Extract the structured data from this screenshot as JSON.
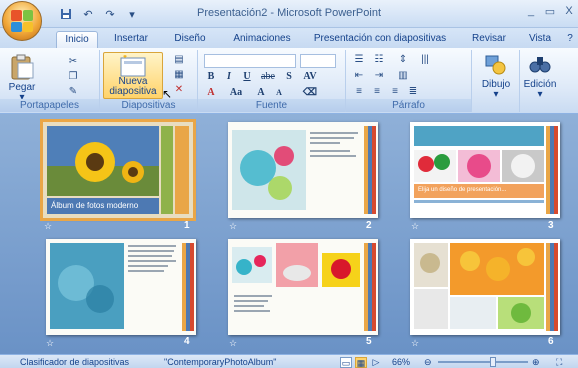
{
  "window": {
    "title": "Presentación2 - Microsoft PowerPoint",
    "controls": [
      "_",
      "▭",
      "X"
    ]
  },
  "quick_access": {
    "save_icon": "save-icon",
    "undo": "↶",
    "redo": "↷"
  },
  "tabs": [
    "Inicio",
    "Insertar",
    "Diseño",
    "Animaciones",
    "Presentación con diapositivas",
    "Revisar",
    "Vista"
  ],
  "ribbon": {
    "portapapeles": {
      "paste_label": "Pegar",
      "group_label": "Portapapeles"
    },
    "diapositivas": {
      "new_slide_line1": "Nueva",
      "new_slide_line2": "diapositiva",
      "group_label": "Diapositivas"
    },
    "fuente": {
      "group_label": "Fuente",
      "bold": "B",
      "italic": "I",
      "underline": "U",
      "strike": "abe",
      "shadow": "S",
      "grow": "A",
      "shrink": "A",
      "color": "A",
      "case": "Aa"
    },
    "parrafo": {
      "group_label": "Párrafo"
    },
    "dibujo": {
      "label": "Dibujo"
    },
    "edicion": {
      "label": "Edición"
    }
  },
  "slides": [
    {
      "number": "1",
      "caption": "Álbum de fotos moderno"
    },
    {
      "number": "2"
    },
    {
      "number": "3",
      "caption": "Elija un diseño de presentación..."
    },
    {
      "number": "4"
    },
    {
      "number": "5"
    },
    {
      "number": "6"
    }
  ],
  "statusbar": {
    "view": "Clasificador de diapositivas",
    "theme": "\"ContemporaryPhotoAlbum\"",
    "zoom": "66%"
  },
  "colors": {
    "accent_orange": "#e9a647",
    "ribbon_blue": "#15428b",
    "slide_bg": "#6f95c4"
  }
}
